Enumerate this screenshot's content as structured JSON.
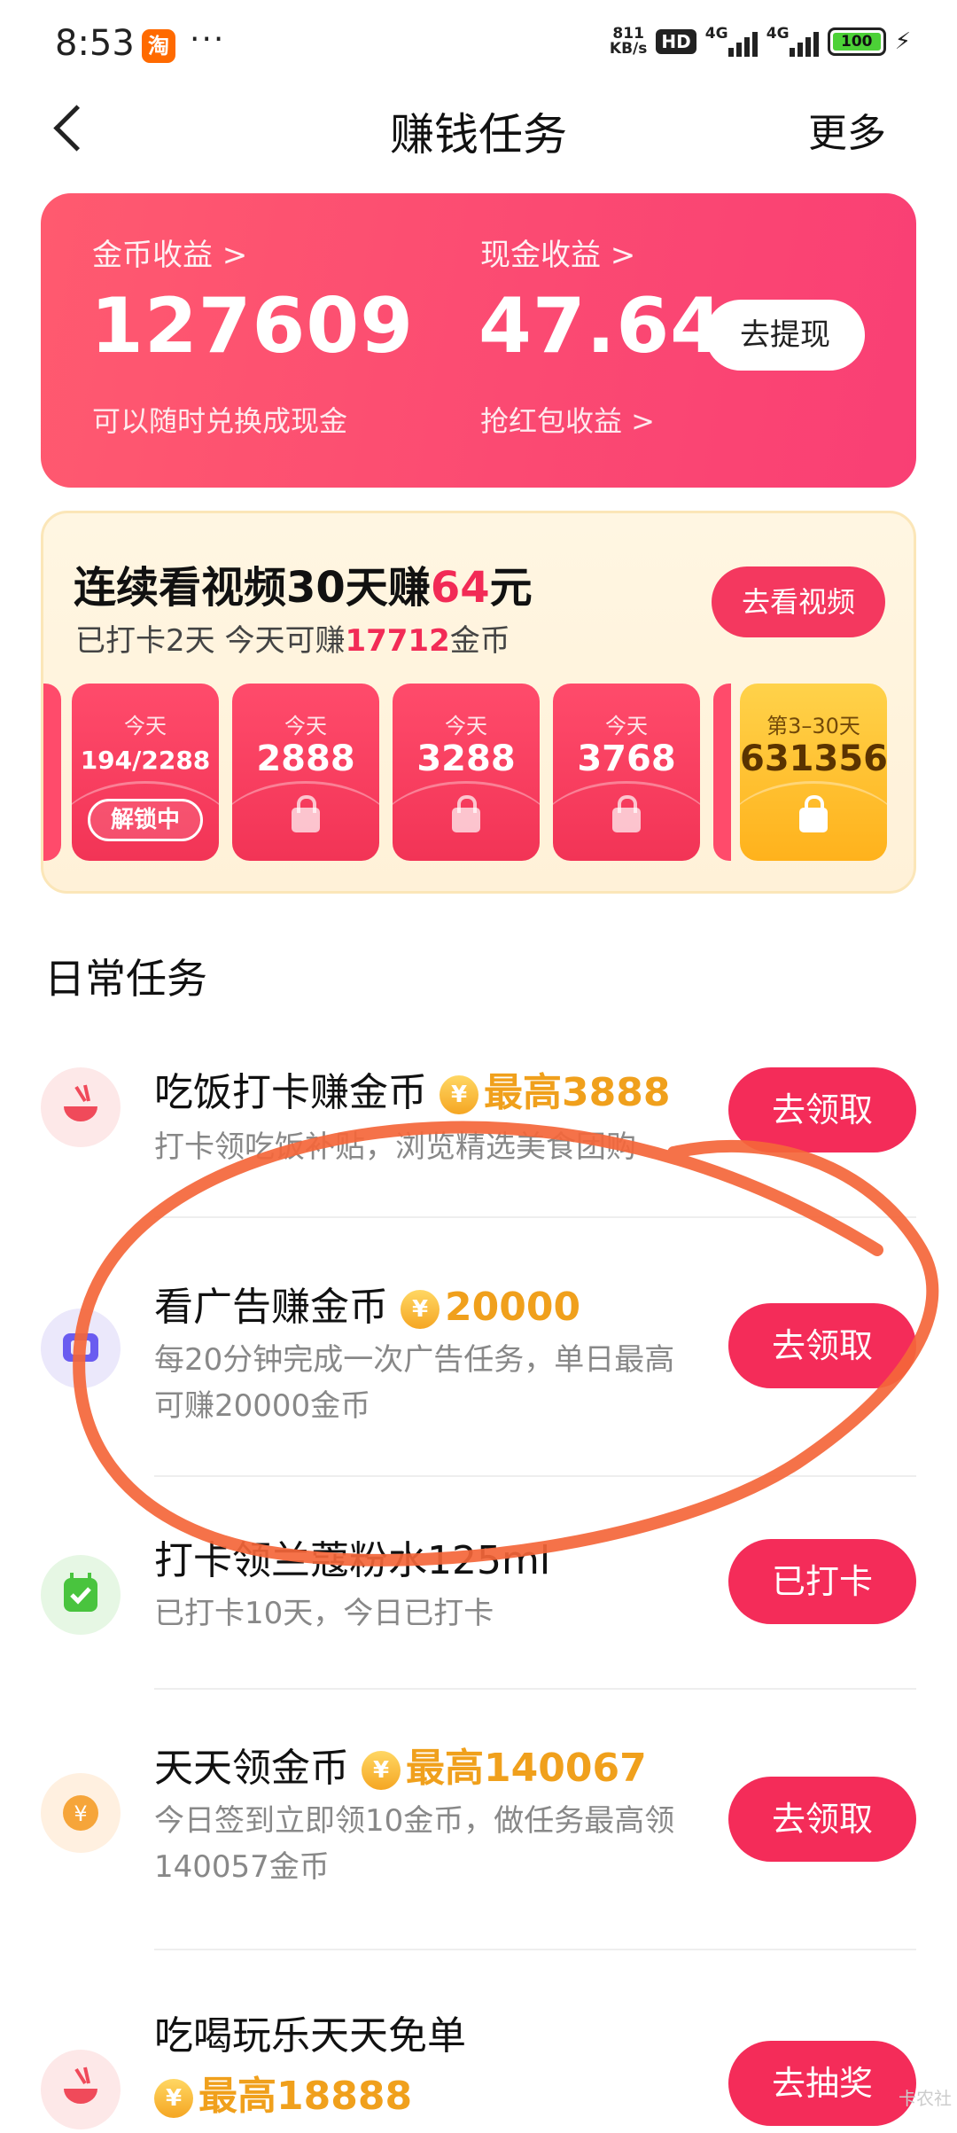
{
  "status_bar": {
    "time": "8:53",
    "app_icon": "淘",
    "more": "···",
    "net_speed_value": "811",
    "net_speed_unit": "KB/s",
    "hd": "HD",
    "net1": "4G",
    "net2": "4G",
    "battery": "100"
  },
  "header": {
    "title": "赚钱任务",
    "more": "更多"
  },
  "earnings": {
    "coin_label": "金币收益 >",
    "coin_value": "127609",
    "coin_sub": "可以随时兑换成现金",
    "cash_label": "现金收益 >",
    "cash_value": "47.64",
    "cash_sub": "抢红包收益 >",
    "withdraw_label": "去提现"
  },
  "video_task": {
    "title_pre": "连续看视频30天赚",
    "title_amount": "64",
    "title_post": "元",
    "sub_pre": "已打卡2天 今天可赚",
    "sub_amount": "17712",
    "sub_post": "金币",
    "button": "去看视频",
    "days": [
      {
        "label": "今天",
        "value": "194/2288",
        "status": "解锁中"
      },
      {
        "label": "今天",
        "value": "2888"
      },
      {
        "label": "今天",
        "value": "3288"
      },
      {
        "label": "今天",
        "value": "3768"
      },
      {
        "label": "第3–30天",
        "value": "631356"
      }
    ]
  },
  "daily": {
    "section_title": "日常任务",
    "coin_symbol": "¥",
    "tasks": [
      {
        "name": "吃饭打卡赚金币",
        "reward": "最高3888",
        "desc": "打卡领吃饭补贴，浏览精选美食团购",
        "button": "去领取",
        "icon": "bowl-icon"
      },
      {
        "name": "看广告赚金币",
        "reward": "20000",
        "desc": "每20分钟完成一次广告任务，单日最高可赚20000金币",
        "button": "去领取",
        "icon": "ad-icon"
      },
      {
        "name": "打卡领兰蔻粉水125ml",
        "reward": "",
        "desc": "已打卡10天，今日已打卡",
        "button": "已打卡",
        "icon": "calendar-check-icon"
      },
      {
        "name": "天天领金币",
        "reward": "最高140067",
        "desc": "今日签到立即领10金币，做任务最高领140057金币",
        "button": "去领取",
        "icon": "coin-icon"
      },
      {
        "name": "吃喝玩乐天天免单",
        "reward": "最高18888",
        "desc": "",
        "button": "去抽奖",
        "icon": "bowl-icon"
      }
    ]
  },
  "watermark": "卡农社"
}
